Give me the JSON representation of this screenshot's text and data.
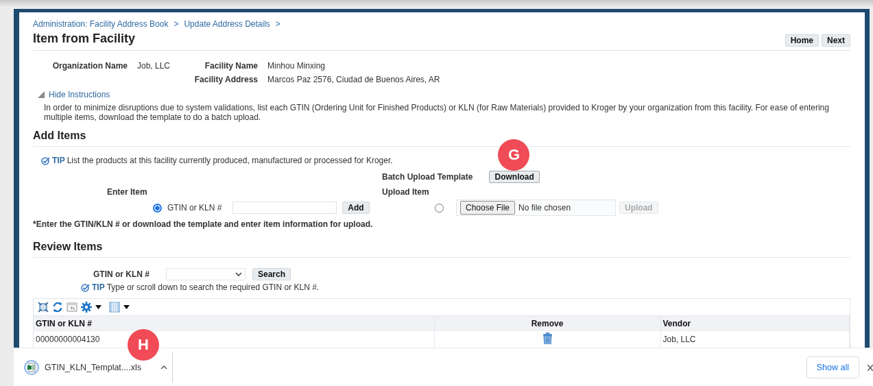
{
  "breadcrumbs": [
    {
      "label": "Administration: Facility Address Book",
      "separator": ">"
    },
    {
      "label": "Update Address Details",
      "separator": ">"
    }
  ],
  "title": "Item from Facility",
  "header_buttons": [
    "Home",
    "Next"
  ],
  "info": [
    {
      "label": "Organization Name",
      "value": "Job, LLC"
    },
    {
      "label": "Facility Name",
      "value": "Minhou Minxing"
    },
    {
      "label": "Facility Address",
      "value": "Marcos Paz 2576, Ciudad de Buenos Aires, AR"
    }
  ],
  "instructions": {
    "toggle_label": "Hide Instructions",
    "expanded": true,
    "text": "In order to minimize disruptions due to system validations, list each GTIN (Ordering Unit for Finished Products) or KLN (for Raw Materials) provided to Kroger by your organization from this facility. For ease of entering multiple items, download the template to do a batch upload."
  },
  "add_items": {
    "heading": "Add Items",
    "tip": {
      "badge": "TIP",
      "text": "List the products at this facility currently produced, manufactured or processed for Kroger."
    },
    "batch_label": "Batch Upload Template",
    "download_button": "Download",
    "callout": "G",
    "enter_label": "Enter Item",
    "upload_label": "Upload Item",
    "manual": {
      "option_label": "GTIN or KLN #",
      "selected": true,
      "button": "Add"
    },
    "upload": {
      "selected": false,
      "choose_button": "Choose File",
      "file_status": "No file chosen",
      "button": "Upload",
      "disabled": true
    },
    "note": "*Enter the GTIN/KLN # or download the template and enter item information for upload."
  },
  "review_items": {
    "heading": "Review Items",
    "search_label": "GTIN or KLN #",
    "search_button": "Search",
    "tip": {
      "badge": "TIP",
      "text": "Type or scroll down to search the required GTIN or KLN #."
    },
    "table": {
      "columns": [
        "GTIN or KLN #",
        "Remove",
        "Vendor"
      ],
      "rows": [
        {
          "gtin": "00000000004130",
          "vendor": "Job, LLC"
        }
      ]
    }
  },
  "download_bar": {
    "file_name": "GTIN_KLN_Templat....xls",
    "callout": "H",
    "show_all": "Show all"
  }
}
